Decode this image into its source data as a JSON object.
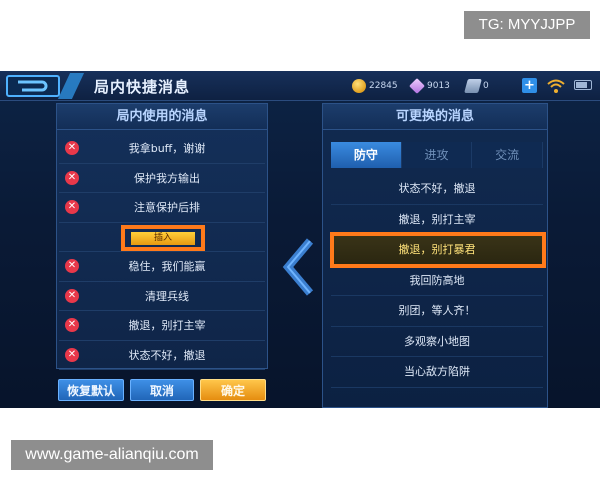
{
  "badges": {
    "tg": "TG: MYYJJPP",
    "site": "www.game-alianqiu.com"
  },
  "topbar": {
    "title": "局内快捷消息",
    "gold": "22845",
    "gems": "9013",
    "coupons": "0",
    "plus": "+"
  },
  "left_panel": {
    "header": "局内使用的消息",
    "messages_top": [
      "我拿buff，谢谢",
      "保护我方输出",
      "注意保护后排"
    ],
    "insert_label": "插入",
    "messages_bottom": [
      "稳住，我们能赢",
      "清理兵线",
      "撤退，别打主宰",
      "状态不好，撤退"
    ]
  },
  "buttons": {
    "reset": "恢复默认",
    "cancel": "取消",
    "confirm": "确定"
  },
  "right_panel": {
    "header": "可更换的消息",
    "tabs": [
      "防守",
      "进攻",
      "交流"
    ],
    "active_tab": "防守",
    "phrases": [
      "状态不好，撤退",
      "撤退，别打主宰",
      "撤退，别打暴君",
      "我回防高地",
      "别团，等人齐！",
      "多观察小地图",
      "当心敌方陷阱"
    ],
    "selected_phrase": "撤退，别打暴君"
  },
  "colors": {
    "highlight_orange": "#ff7a1a",
    "remove_red": "#e8384a",
    "tab_active_blue": "#2f7fd6",
    "confirm_gold": "#f0a020"
  },
  "icons": [
    "back-arrow-icon",
    "gold-coin-icon",
    "diamond-icon",
    "coupon-icon",
    "plus-icon",
    "wifi-icon",
    "battery-icon",
    "remove-icon",
    "chevron-left-icon"
  ]
}
